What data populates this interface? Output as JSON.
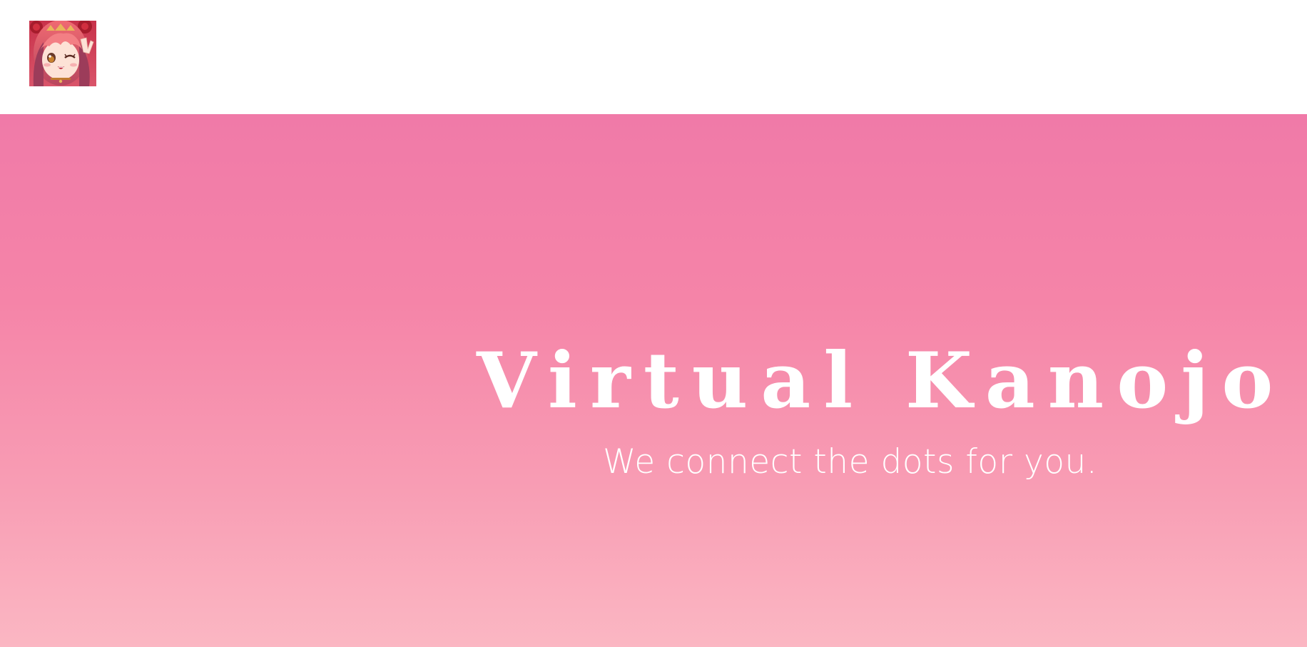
{
  "header": {
    "logo_icon": "anime-girl-avatar-icon"
  },
  "hero": {
    "title": "Virtual Kanojo",
    "tagline": "We connect the dots for you."
  },
  "colors": {
    "header_bg": "#ffffff",
    "hero_top": "#f07aa8",
    "hero_bottom": "#fbb7c3",
    "text": "#ffffff"
  }
}
